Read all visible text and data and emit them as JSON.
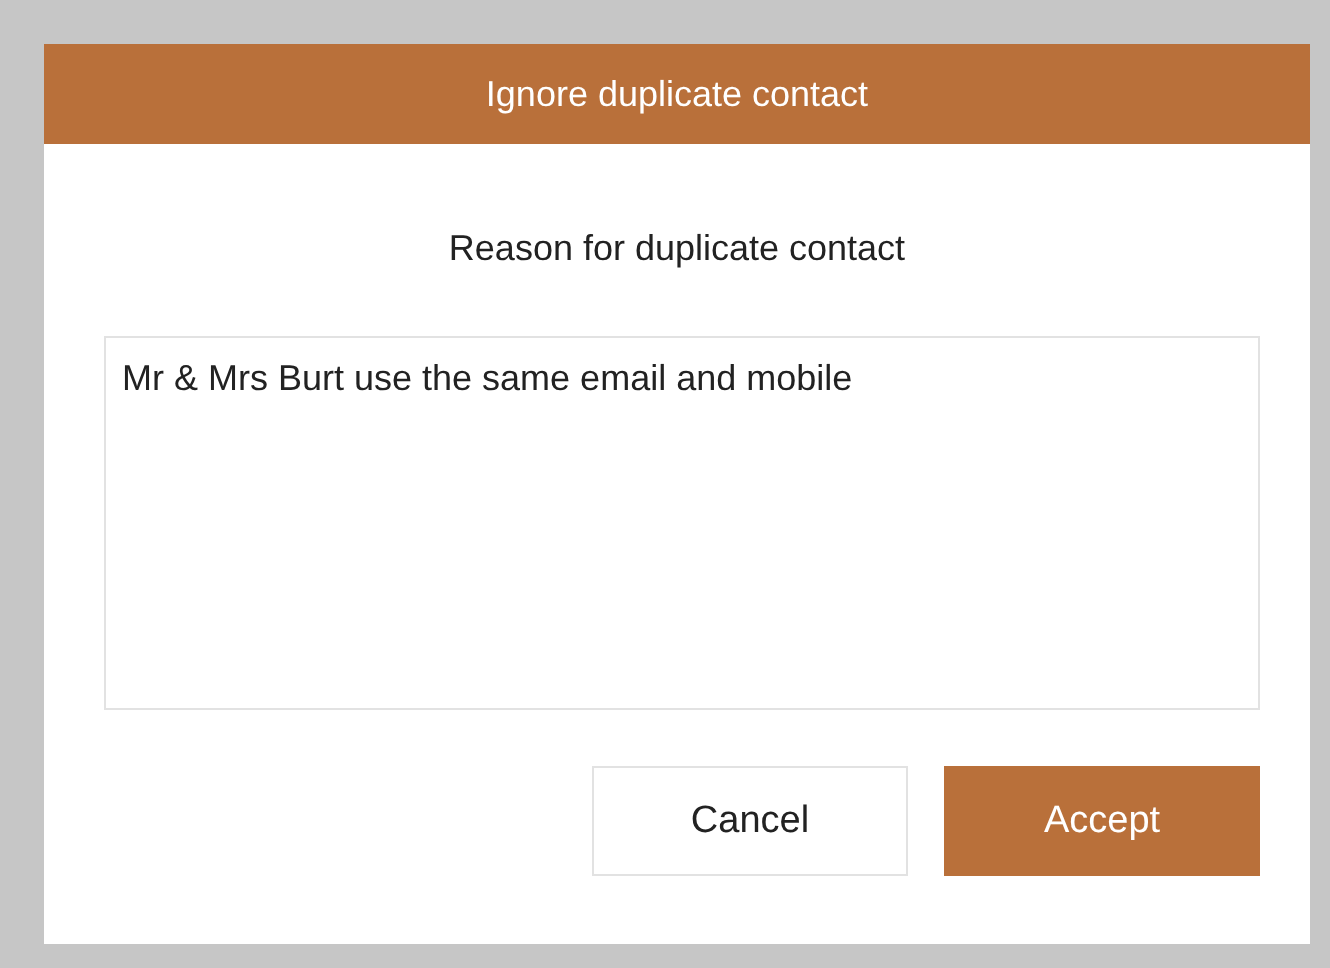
{
  "window": {
    "title": "Ignore duplicate contact"
  },
  "prompt": "Reason for duplicate contact",
  "reason_field": {
    "value": "Mr & Mrs Burt use the same email and mobile"
  },
  "buttons": [
    {
      "label": "Cancel",
      "kind": "secondary"
    },
    {
      "label": "Accept",
      "kind": "primary"
    }
  ]
}
